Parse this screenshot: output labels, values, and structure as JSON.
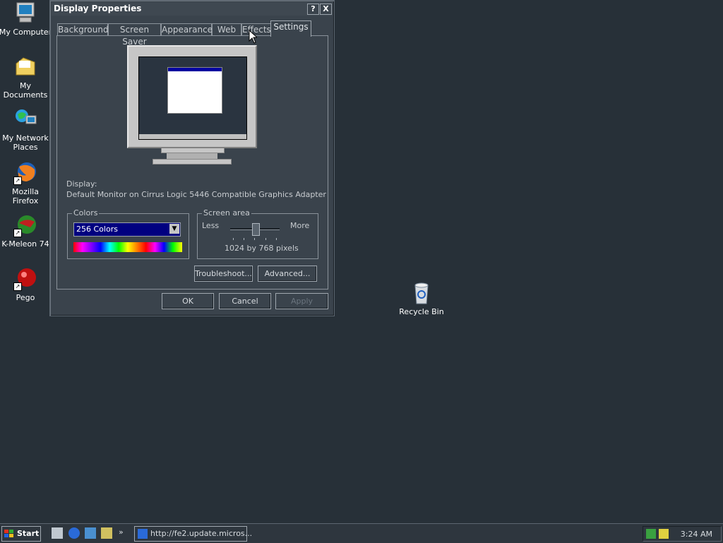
{
  "desktop": {
    "icons": [
      {
        "label": "My Computer"
      },
      {
        "label": "My Documents"
      },
      {
        "label": "My Network Places"
      },
      {
        "label": "Mozilla Firefox"
      },
      {
        "label": "K-Meleon 74"
      },
      {
        "label": "Pego"
      },
      {
        "label": "Recycle Bin"
      }
    ]
  },
  "dialog": {
    "title": "Display Properties",
    "help_button": "?",
    "close_button": "X",
    "tabs": [
      {
        "label": "Background"
      },
      {
        "label": "Screen Saver"
      },
      {
        "label": "Appearance"
      },
      {
        "label": "Web"
      },
      {
        "label": "Effects"
      },
      {
        "label": "Settings",
        "active": true
      }
    ],
    "display_label": "Display:",
    "display_value": "Default Monitor on Cirrus Logic 5446 Compatible Graphics Adapter",
    "colors": {
      "group_label": "Colors",
      "selected": "256 Colors"
    },
    "screen_area": {
      "group_label": "Screen area",
      "less": "Less",
      "more": "More",
      "value": "1024 by 768 pixels",
      "slider_fraction": 0.5
    },
    "troubleshoot": "Troubleshoot...",
    "advanced": "Advanced...",
    "ok": "OK",
    "cancel": "Cancel",
    "apply": "Apply"
  },
  "taskbar": {
    "start": "Start",
    "chevron": "»",
    "task_button": "http://fe2.update.micros...",
    "clock": "3:24 AM"
  }
}
